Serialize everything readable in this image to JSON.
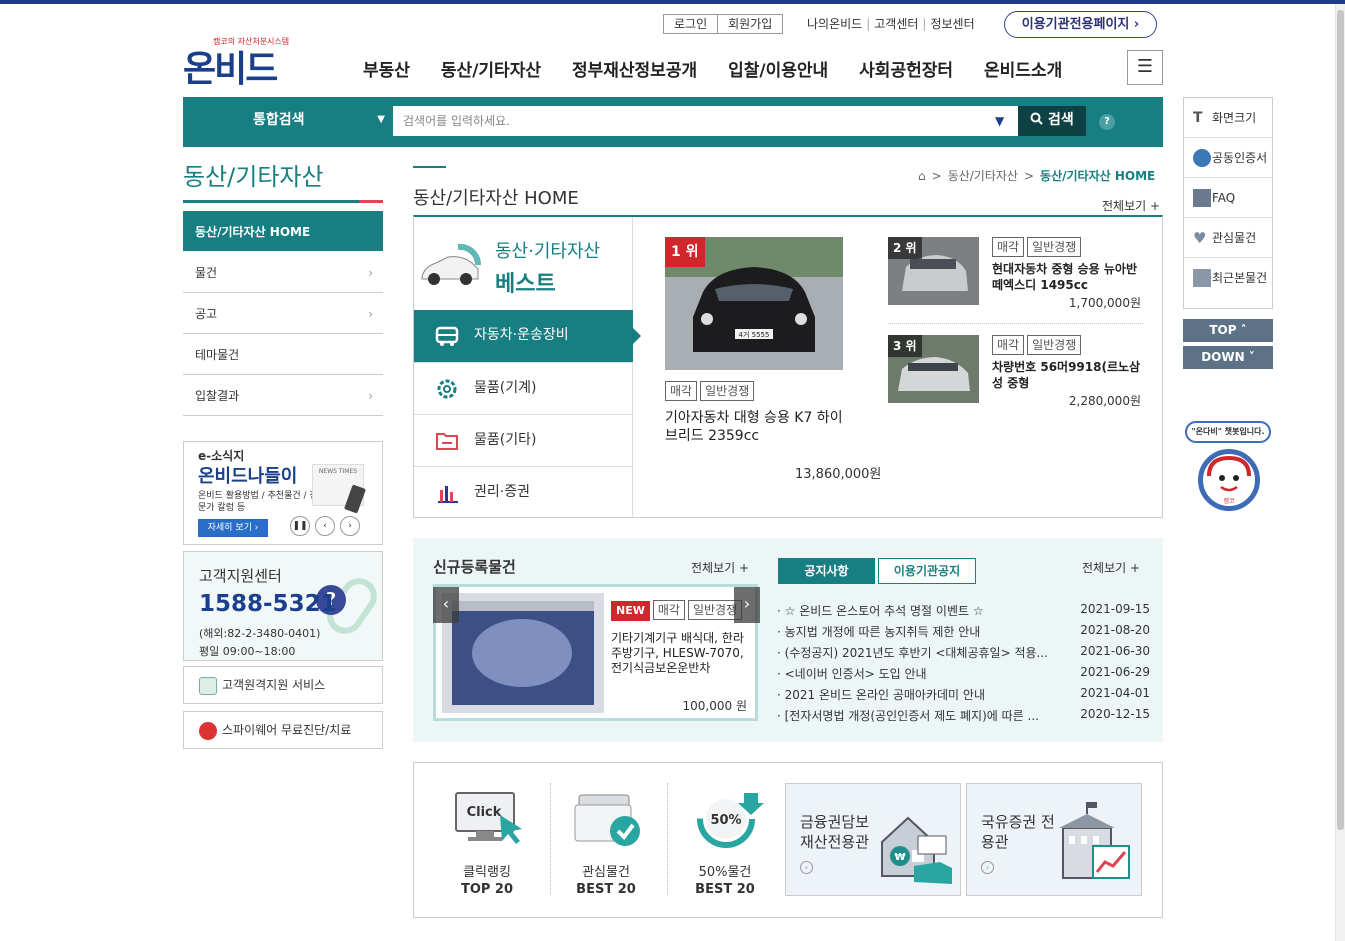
{
  "header": {
    "logo_sub": "캠코의 자산처분시스템",
    "logo_main": "온비드",
    "login": "로그인",
    "join": "회원가입",
    "links": [
      "나의온비드",
      "고객센터",
      "정보센터"
    ],
    "org_page": "이용기관전용페이지"
  },
  "gnb": [
    "부동산",
    "동산/기타자산",
    "정부재산정보공개",
    "입찰/이용안내",
    "사회공헌장터",
    "온비드소개"
  ],
  "search": {
    "scope": "통합검색",
    "placeholder": "검색어를 입력하세요.",
    "button": "검색",
    "help": "?"
  },
  "lnb": {
    "title": "동산/기타자산",
    "active": "동산/기타자산 HOME",
    "items": [
      "물건",
      "공고",
      "테마물건",
      "입찰결과"
    ]
  },
  "banner_e": {
    "t1": "e-소식지",
    "t2": "온비드나들이",
    "t3": "온비드 활용방법 / 추천물건 / 전문가 칼럼 등",
    "more": "자세히 보기 ›",
    "paper": "NEWS TIMES"
  },
  "cs": {
    "title": "고객지원센터",
    "phone": "1588-5321",
    "overseas": "(해외:82-2-3480-0401)",
    "hours": "평일 09:00~18:00"
  },
  "services": [
    "고객원격지원 서비스",
    "스파이웨어 무료진단/치료"
  ],
  "main": {
    "page_title": "동산/기타자산 HOME",
    "breadcrumb": [
      "동산/기타자산",
      "동산/기타자산 HOME"
    ],
    "view_all": "전체보기 +"
  },
  "best": {
    "h1": "동산·기타자산",
    "h2": "베스트",
    "categories": [
      "자동차·운송장비",
      "물품(기계)",
      "물품(기타)",
      "권리·증권"
    ],
    "rank1": {
      "badge": "1 위",
      "tags": [
        "매각",
        "일반경쟁"
      ],
      "name": "기아자동차 대형 승용 K7 하이브리드 2359cc",
      "price": "13,860,000원",
      "plate": "4거 5555"
    },
    "rank2": {
      "badge": "2 위",
      "tags": [
        "매각",
        "일반경쟁"
      ],
      "name": "현대자동차 중형 승용 뉴아반떼엑스디 1495cc",
      "price": "1,700,000원"
    },
    "rank3": {
      "badge": "3 위",
      "tags": [
        "매각",
        "일반경쟁"
      ],
      "name": "차량번호 56머9918(르노삼성 중형",
      "price": "2,280,000원"
    }
  },
  "new_items": {
    "title": "신규등록물건",
    "view_all": "전체보기 +",
    "tags": [
      "NEW",
      "매각",
      "일반경쟁"
    ],
    "name": "기타기계기구 배식대, 한라주방기구, HLESW-7070, 전기식금보온운반차",
    "price": "100,000 원"
  },
  "notices": {
    "tab_on": "공지사항",
    "tab_off": "이용기관공지",
    "view_all": "전체보기 +",
    "items": [
      {
        "text": "· ☆ 온비드 온스토어 추석 명절 이벤트 ☆",
        "date": "2021-09-15"
      },
      {
        "text": "· 농지법 개정에 따른 농지취득 제한 안내",
        "date": "2021-08-20"
      },
      {
        "text": "· (수정공지) 2021년도 후반기 <대체공휴일> 적용...",
        "date": "2021-06-30"
      },
      {
        "text": "· <네이버 인증서> 도입 안내",
        "date": "2021-06-29"
      },
      {
        "text": "· 2021 온비드 온라인 공매아카데미 안내",
        "date": "2021-04-01"
      },
      {
        "text": "· [전자서명법 개정(공인인증서 제도 폐지)에 따른 ...",
        "date": "2020-12-15"
      }
    ]
  },
  "bottom": {
    "quick": [
      {
        "label1": "클릭랭킹",
        "label2": "TOP 20",
        "icon_text": "Click"
      },
      {
        "label1": "관심물건",
        "label2": "BEST 20"
      },
      {
        "label1": "50%물건",
        "label2": "BEST 20",
        "icon_text": "50%"
      }
    ],
    "banner1": "금융권담보 재산전용관",
    "banner2": "국유증권 전용관"
  },
  "quick_menu": {
    "items": [
      "화면크기",
      "공동인증서",
      "FAQ",
      "관심물건",
      "최근본물건"
    ],
    "top": "TOP ˄",
    "down": "DOWN ˅",
    "chatbot": "\"온다비\" 챗봇입니다.",
    "chatbot_name": "캠코"
  },
  "colors": {
    "primary": "#177f82",
    "navy": "#1b3f8b",
    "accent": "#d0272c"
  }
}
